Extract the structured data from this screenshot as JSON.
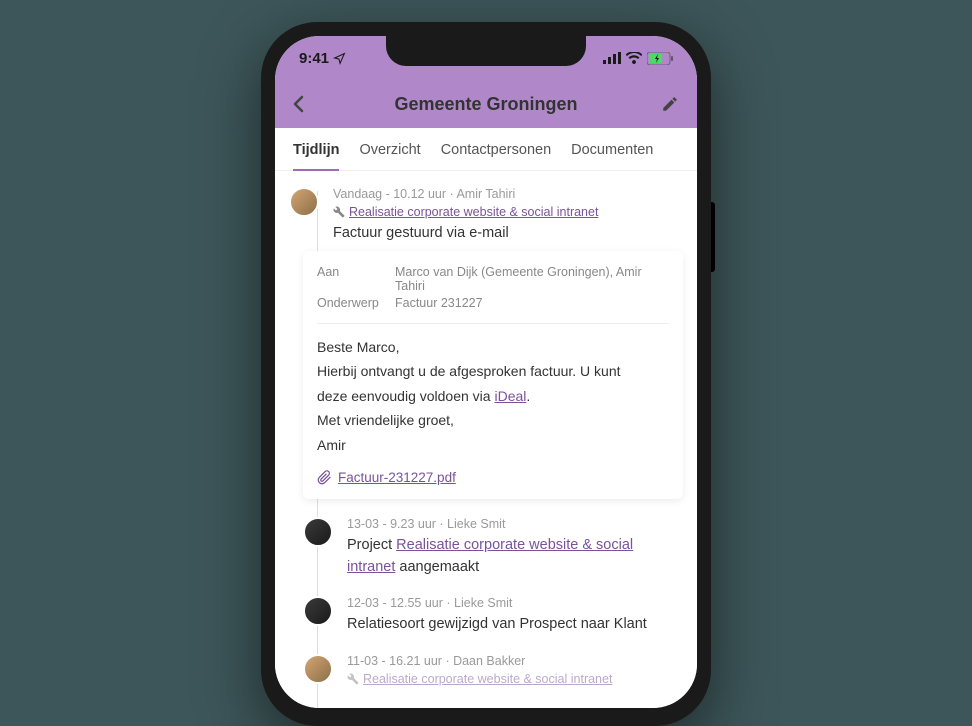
{
  "statusBar": {
    "time": "9:41"
  },
  "header": {
    "title": "Gemeente Groningen"
  },
  "tabs": [
    {
      "label": "Tijdlijn",
      "active": true
    },
    {
      "label": "Overzicht",
      "active": false
    },
    {
      "label": "Contactpersonen",
      "active": false
    },
    {
      "label": "Documenten",
      "active": false
    }
  ],
  "entries": [
    {
      "meta": "Vandaag - 10.12 uur · Amir Tahiri",
      "projectLink": "Realisatie corporate website & social intranet",
      "title": "Factuur gestuurd via e-mail",
      "emailCard": {
        "to": {
          "label": "Aan",
          "value": "Marco van Dijk (Gemeente Groningen), Amir Tahiri"
        },
        "subject": {
          "label": "Onderwerp",
          "value": "Factuur 231227"
        },
        "greeting": "Beste Marco,",
        "line1a": "Hierbij ontvangt u de afgesproken factuur. U kunt ",
        "line1b": "deze eenvoudig voldoen via ",
        "idealLink": "iDeal",
        "closing": "Met vriendelijke groet,",
        "signature": "Amir",
        "attachment": "Factuur-231227.pdf"
      }
    },
    {
      "meta": "13-03 - 9.23 uur · Lieke Smit",
      "textPrefix": "Project ",
      "textLink": "Realisatie corporate website & social intranet",
      "textSuffix": " aangemaakt"
    },
    {
      "meta": "12-03 - 12.55 uur · Lieke Smit",
      "text": "Relatiesoort gewijzigd van Prospect naar Klant"
    },
    {
      "meta": "11-03 - 16.21 uur · Daan Bakker",
      "projectLinkPartial": "Realisatie corporate website & social intranet"
    }
  ]
}
